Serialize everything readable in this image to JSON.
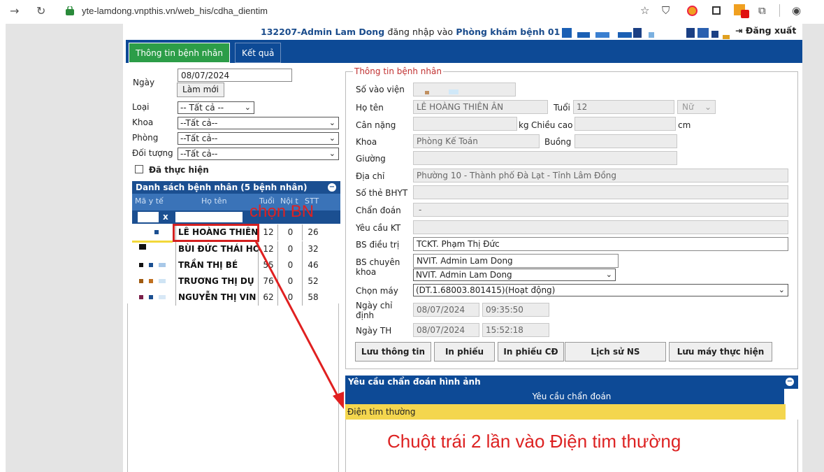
{
  "browser": {
    "url": "yte-lamdong.vnpthis.vn/web_his/cdha_dientim"
  },
  "header": {
    "user": "132207-Admin Lam Dong",
    "login_text": "đăng nhập vào",
    "room": "Phòng khám bệnh 01",
    "logout": "Đăng xuất"
  },
  "tabs": [
    "Thông tin bệnh nhân",
    "Kết quả"
  ],
  "filters": {
    "date_label": "Ngày",
    "date_value": "08/07/2024",
    "refresh": "Làm mới",
    "type_label": "Loại",
    "type_value": "-- Tất cả --",
    "dept_label": "Khoa",
    "dept_value": "--Tất cả--",
    "room_label": "Phòng",
    "room_value": "--Tất cả--",
    "subject_label": "Đối tượng",
    "subject_value": "--Tất cả--",
    "done_label": "Đã thực hiện"
  },
  "patient_list": {
    "title": "Danh sách bệnh nhân (5 bệnh nhân)",
    "columns": [
      "Mã y tế",
      "Họ tên",
      "Tuổi",
      "Nội t",
      "STT"
    ],
    "filter_clear": "x",
    "rows": [
      {
        "name": "LÊ HOÀNG THIÊN",
        "age": "12",
        "noi": "0",
        "stt": "26"
      },
      {
        "name": "BÙI ĐỨC THÁI HO",
        "age": "12",
        "noi": "0",
        "stt": "32"
      },
      {
        "name": "TRẦN THỊ BÉ",
        "age": "55",
        "noi": "0",
        "stt": "46"
      },
      {
        "name": "TRƯƠNG THỊ DỤ",
        "age": "76",
        "noi": "0",
        "stt": "52"
      },
      {
        "name": "NGUYỄN THỊ VIN",
        "age": "62",
        "noi": "0",
        "stt": "58"
      }
    ]
  },
  "info": {
    "legend": "Thông tin bệnh nhân",
    "admission_label": "Số vào viện",
    "name_label": "Họ tên",
    "name_value": "LÊ HOÀNG THIÊN ÂN",
    "age_label": "Tuổi",
    "age_value": "12",
    "gender_value": "Nữ",
    "weight_label": "Cân nặng",
    "weight_unit": "kg",
    "height_label": "Chiều cao",
    "height_unit": "cm",
    "dept_label": "Khoa",
    "dept_value": "Phòng Kế Toán",
    "room_label": "Buồng",
    "bed_label": "Giường",
    "address_label": "Địa chỉ",
    "address_value": "Phường 10 - Thành phố Đà Lạt - Tỉnh Lâm Đồng",
    "bhyt_label": "Số thẻ BHYT",
    "diagnosis_label": "Chẩn đoán",
    "diagnosis_value": "-",
    "request_label": "Yêu cầu KT",
    "doctor_label": "BS điều trị",
    "doctor_value": "TCKT. Phạm Thị Đức",
    "specialist_label_1": "BS chuyên",
    "specialist_label_2": "khoa",
    "specialist_value_1": "NVIT. Admin Lam Dong",
    "specialist_value_2": "NVIT. Admin Lam Dong",
    "machine_label": "Chọn máy",
    "machine_value": "(DT.1.68003.801415)(Hoạt động)",
    "order_date_label_1": "Ngày chỉ",
    "order_date_label_2": "định",
    "order_date": "08/07/2024",
    "order_time": "09:35:50",
    "exec_date_label": "Ngày TH",
    "exec_date": "08/07/2024",
    "exec_time": "15:52:18"
  },
  "actions": [
    "Lưu thông tin",
    "In phiếu",
    "In phiếu CĐ",
    "Lịch sử NS",
    "Lưu máy thực hiện"
  ],
  "requests": {
    "title": "Yêu cầu chẩn đoán hình ảnh",
    "column": "Yêu cầu chẩn đoán",
    "items": [
      "Điện tim thường"
    ]
  },
  "annotations": {
    "select_patient": "chọn BN",
    "instruction": "Chuột trái 2 lần vào Điện tim thường"
  },
  "colors": {
    "nav_blue": "#0d4a96",
    "tab_green": "#2c9d48",
    "highlight_yellow": "#f4d64e",
    "annotation_red": "#dd2222"
  }
}
